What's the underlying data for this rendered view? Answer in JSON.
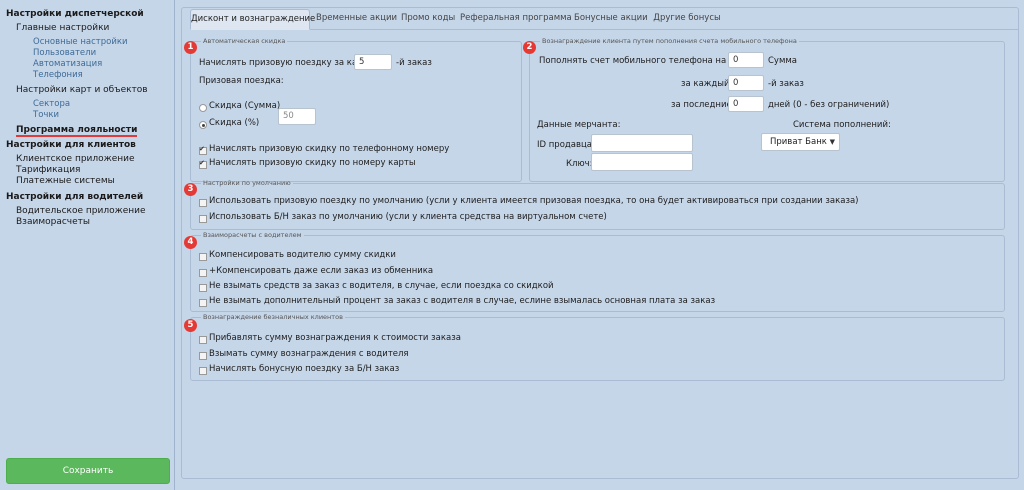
{
  "sidebar": {
    "dispatcher": "Настройки диспетчерской",
    "main_settings": "Главные настройки",
    "basic_settings": "Основные настройки",
    "users": "Пользователи",
    "automation": "Автоматизация",
    "phones": "Телефония",
    "maps_objects": "Настройки карт и объектов",
    "sectors": "Сектора",
    "points": "Точки",
    "loyalty": "Программа лояльности",
    "clients": "Настройки для клиентов",
    "client_app": "Клиентское приложение",
    "tariff": "Тарификация",
    "payment_systems": "Платежные системы",
    "drivers": "Настройки для водителей",
    "driver_app": "Водительское приложение",
    "settlements": "Взаиморасчеты",
    "save": "Сохранить"
  },
  "tabs": [
    "Дисконт и вознаграждение",
    "Временные акции",
    "Промо коды",
    "Реферальная программа",
    "Бонусные акции",
    "Другие бонусы"
  ],
  "badges": [
    "1",
    "2",
    "3",
    "4",
    "5"
  ],
  "auto_discount": {
    "legend": "Автоматическая скидка",
    "every_label": "Начислять призовую поездку за каждый",
    "every_value": "5",
    "order_suffix": "-й заказ",
    "prize_label": "Призовая поездка:",
    "radio_sum": "Скидка (Сумма)",
    "radio_percent": "Скидка (%)",
    "percent_value": "50",
    "by_phone": "Начислять призовую скидку по телефонному номеру",
    "by_card": "Начислять призовую скидку по номеру карты"
  },
  "mobile_reward": {
    "legend": "Вознаграждение клиента путем пополнения счета мобильного телефона",
    "topup_label": "Пополнять счет мобильного телефона на сумму",
    "topup_value": "0",
    "sum_suffix": "Сумма",
    "every_label": "за каждый",
    "every_value": "0",
    "order_suffix": "-й заказ",
    "last_label": "за последние",
    "last_value": "0",
    "days_suffix": "дней (0 - без ограничений)",
    "merchant_label": "Данные мерчанта:",
    "seller_id_label": "ID продавца:",
    "key_label": "Ключ:",
    "system_label": "Система пополнений:",
    "system_value": "Приват Банк"
  },
  "defaults": {
    "legend": "Настройки по умолчанию",
    "use_prize": "Использовать призовую поездку по умолчанию (усли у клиента имеется призовая поездка, то она будет активироваться при создании заказа)",
    "use_cashless": "Использовать Б/Н заказ по умолчанию (усли у клиента средства на виртуальном счете)"
  },
  "settlements": {
    "legend": "Взаиморасчеты с водителем",
    "compensate": "Компенсировать водителю сумму скидки",
    "compensate_exchanger": "+Компенсировать даже если заказ из обменника",
    "no_charge": "Не взымать средств за заказ с водителя, в случае, если поездка со скидкой",
    "no_extra": "Не взымать дополнительный процент за заказ с водителя в случае, еслине взымалась основная плата за заказ"
  },
  "cashless": {
    "legend": "Вознаграждение безналичных клиентов",
    "add_reward": "Прибавлять сумму вознаграждения к стоимости заказа",
    "charge_driver": "Взымать сумму вознаграждения с водителя",
    "bonus_trip": "Начислять бонусную поездку за Б/Н заказ"
  },
  "colors": {
    "background": "#c6d6e9",
    "accent_red": "#e53935",
    "save_green": "#5cb85c"
  }
}
